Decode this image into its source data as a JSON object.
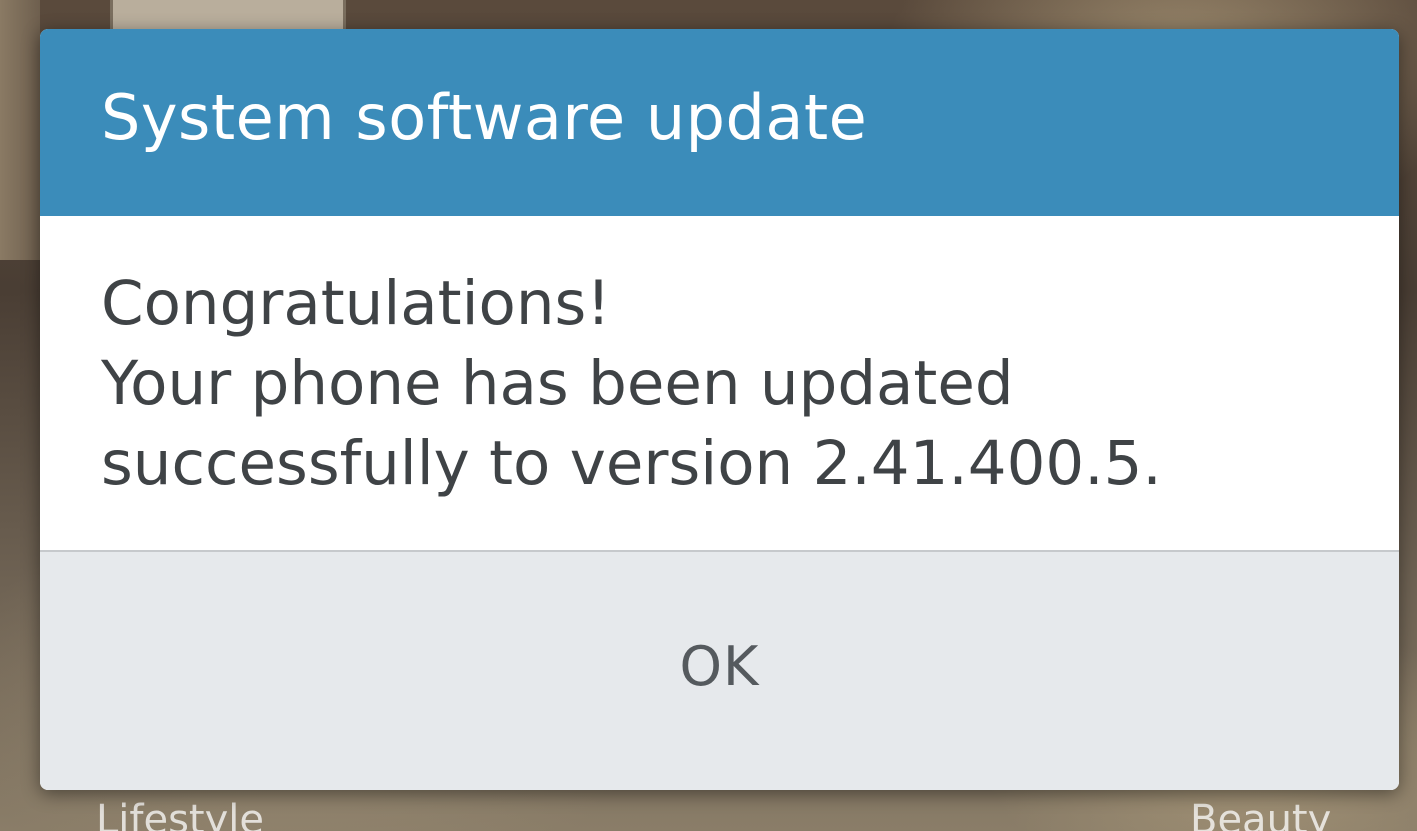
{
  "dialog": {
    "title": "System software update",
    "message_lines": [
      "Congratulations!",
      "Your phone has been updated",
      "successfully to version 2.41.400.5."
    ],
    "ok_label": "OK"
  },
  "background": {
    "left_label": "Lifestyle",
    "right_label": "Beauty"
  },
  "colors": {
    "header": "#3b8cba",
    "footer": "#e6e9ec",
    "body_text": "#3f4346"
  }
}
